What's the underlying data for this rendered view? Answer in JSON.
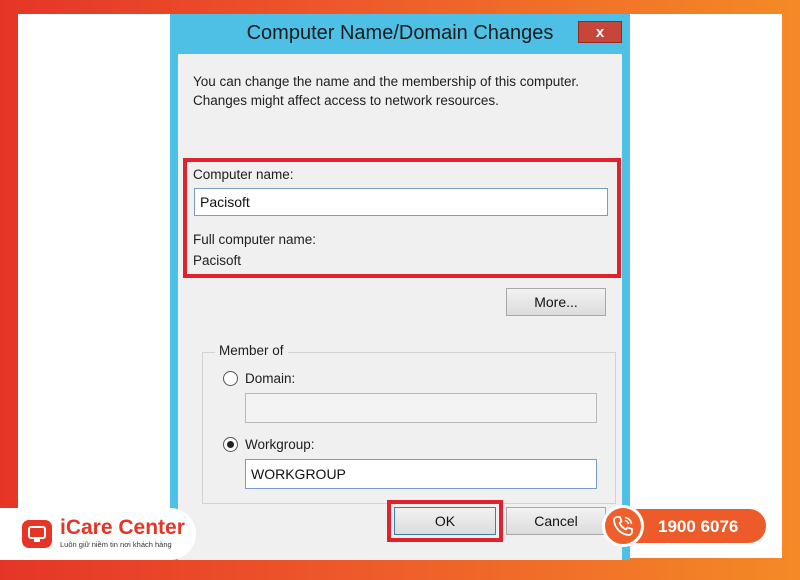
{
  "dialog": {
    "title": "Computer Name/Domain Changes",
    "close_label": "x",
    "description": "You can change the name and the membership of this computer. Changes might affect access to network resources.",
    "computer_name_label": "Computer name:",
    "computer_name_value": "Pacisoft",
    "full_name_label": "Full computer name:",
    "full_name_value": "Pacisoft",
    "more_button": "More...",
    "member_of": {
      "legend": "Member of",
      "domain_label": "Domain:",
      "domain_value": "",
      "domain_selected": false,
      "workgroup_label": "Workgroup:",
      "workgroup_value": "WORKGROUP",
      "workgroup_selected": true
    },
    "ok_button": "OK",
    "cancel_button": "Cancel"
  },
  "branding": {
    "logo_text": "iCare Center",
    "logo_tagline": "Luôn giữ niềm tin nơi khách hàng",
    "phone": "1900 6076"
  },
  "colors": {
    "highlight": "#e0212e",
    "dialog_frame": "#4ec0e6",
    "brand_orange": "#ee5b2b",
    "brand_red": "#e53527"
  }
}
